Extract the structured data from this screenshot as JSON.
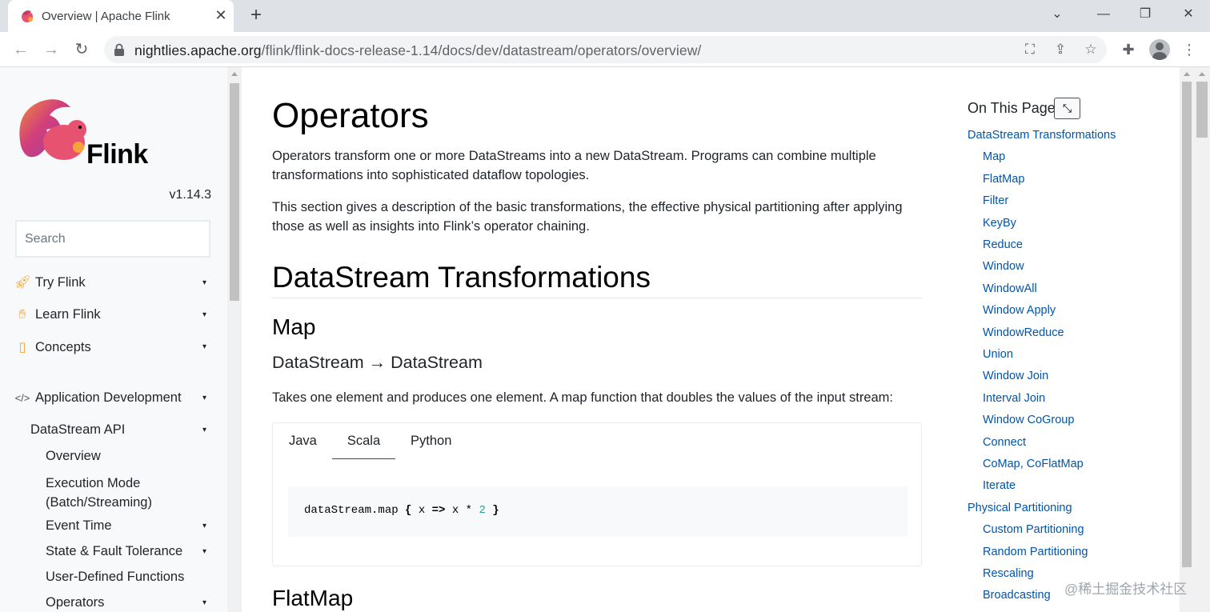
{
  "browser": {
    "tab_title": "Overview | Apache Flink",
    "url_host": "nightlies.apache.org",
    "url_path": "/flink/flink-docs-release-1.14/docs/dev/datastream/operators/overview/",
    "icons": [
      "back-arrow-icon",
      "forward-arrow-icon",
      "reload-icon",
      "lock-icon",
      "translate-icon",
      "share-icon",
      "star-icon",
      "extensions-icon",
      "profile-icon",
      "kebab-menu-icon"
    ]
  },
  "sidebar": {
    "logo_text": "Flink",
    "version": "v1.14.3",
    "search_placeholder": "Search",
    "items": [
      {
        "label": "Try Flink",
        "icon": "rocket-icon",
        "caret": "▾"
      },
      {
        "label": "Learn Flink",
        "icon": "hand-icon",
        "caret": "▾"
      },
      {
        "label": "Concepts",
        "icon": "map-icon",
        "caret": "▾"
      },
      {
        "label": "Application Development",
        "icon": "code-icon",
        "caret": "▾"
      },
      {
        "label": "DataStream API",
        "caret": "▾"
      },
      {
        "label": "Overview"
      },
      {
        "label": "Execution Mode",
        "label2": "(Batch/Streaming)"
      },
      {
        "label": "Event Time",
        "caret": "▾"
      },
      {
        "label": "State & Fault Tolerance",
        "caret": "▾"
      },
      {
        "label": "User-Defined Functions"
      },
      {
        "label": "Operators",
        "caret": "▾"
      }
    ]
  },
  "main": {
    "title": "Operators",
    "intro1": "Operators transform one or more DataStreams into a new DataStream. Programs can combine multiple transformations into sophisticated dataflow topologies.",
    "intro2": "This section gives a description of the basic transformations, the effective physical partitioning after applying those as well as insights into Flink’s operator chaining.",
    "section_title": "DataStream Transformations",
    "map_title": "Map",
    "map_signature": "DataStream → DataStream",
    "map_desc": "Takes one element and produces one element. A map function that doubles the values of the input stream:",
    "code_tabs": [
      "Java",
      "Scala",
      "Python"
    ],
    "active_tab": "Scala",
    "code": {
      "prefix": "dataStream.map ",
      "brace_open": "{",
      "x1": " x ",
      "arrow": "=>",
      "rest": " x * ",
      "num": "2",
      "brace_close": " }"
    },
    "next_title": "FlatMap"
  },
  "toc": {
    "title": "On This Page",
    "toggle_icon": "compress-icon",
    "links": [
      {
        "label": "DataStream Transformations",
        "level": 1
      },
      {
        "label": "Map",
        "level": 2
      },
      {
        "label": "FlatMap",
        "level": 2
      },
      {
        "label": "Filter",
        "level": 2
      },
      {
        "label": "KeyBy",
        "level": 2
      },
      {
        "label": "Reduce",
        "level": 2
      },
      {
        "label": "Window",
        "level": 2
      },
      {
        "label": "WindowAll",
        "level": 2
      },
      {
        "label": "Window Apply",
        "level": 2
      },
      {
        "label": "WindowReduce",
        "level": 2
      },
      {
        "label": "Union",
        "level": 2
      },
      {
        "label": "Window Join",
        "level": 2
      },
      {
        "label": "Interval Join",
        "level": 2
      },
      {
        "label": "Window CoGroup",
        "level": 2
      },
      {
        "label": "Connect",
        "level": 2
      },
      {
        "label": "CoMap, CoFlatMap",
        "level": 2
      },
      {
        "label": "Iterate",
        "level": 2
      },
      {
        "label": "Physical Partitioning",
        "level": 1
      },
      {
        "label": "Custom Partitioning",
        "level": 2
      },
      {
        "label": "Random Partitioning",
        "level": 2
      },
      {
        "label": "Rescaling",
        "level": 2
      },
      {
        "label": "Broadcasting",
        "level": 2
      }
    ]
  },
  "watermark": "@稀土掘金技术社区",
  "colors": {
    "link": "#0055aa",
    "accent_tab_underline": "#0055aa",
    "sidebar_bg": "#f8f9fa"
  }
}
